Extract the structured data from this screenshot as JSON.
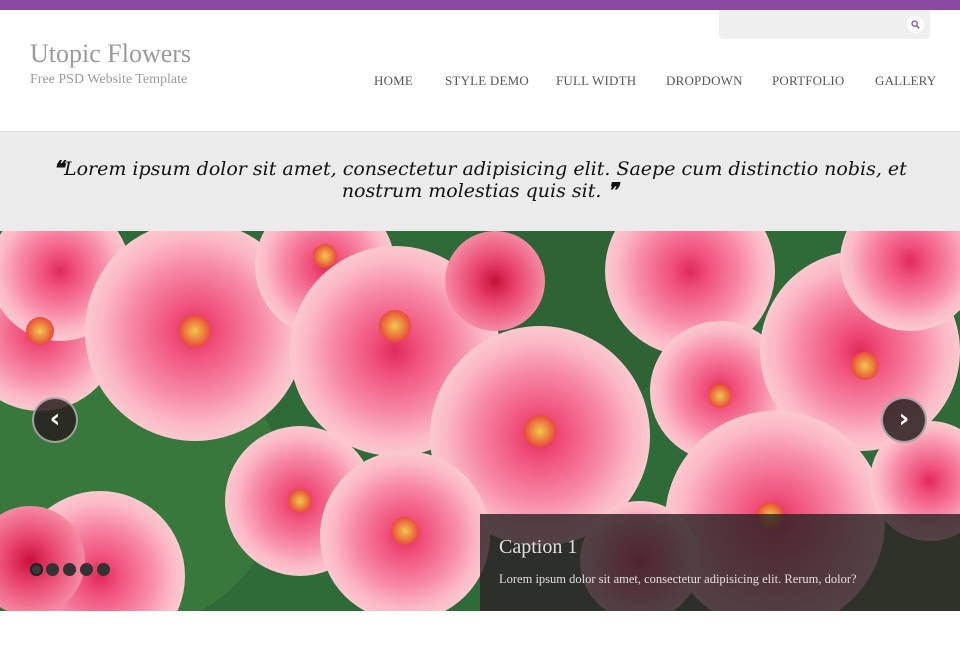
{
  "colors": {
    "accent": "#8a4aa3",
    "quote_band": "#ebebeb",
    "caption_overlay": "#2d2326"
  },
  "search": {
    "placeholder": "",
    "icon": "search-icon"
  },
  "header": {
    "site_title": "Utopic Flowers",
    "tagline": "Free PSD Website Template"
  },
  "nav": {
    "items": [
      {
        "label": "HOME"
      },
      {
        "label": "STYLE DEMO"
      },
      {
        "label": "FULL WIDTH"
      },
      {
        "label": "DROPDOWN"
      },
      {
        "label": "PORTFOLIO"
      },
      {
        "label": "GALLERY"
      }
    ]
  },
  "quote": {
    "open_mark": "❝",
    "text": "Lorem ipsum dolor sit amet, consectetur adipisicing elit. Saepe cum distinctio nobis, et nostrum molestias quis sit.",
    "close_mark": "❞"
  },
  "slider": {
    "image_description_icon": "pink-chrysanthemums-photo",
    "prev_icon": "chevron-left-icon",
    "next_icon": "chevron-right-icon",
    "prev_glyph": "‹",
    "next_glyph": "›",
    "slide_count": 5,
    "active_slide": 1,
    "caption": {
      "title": "Caption 1",
      "text": "Lorem ipsum dolor sit amet, consectetur adipisicing elit. Rerum, dolor?"
    }
  }
}
